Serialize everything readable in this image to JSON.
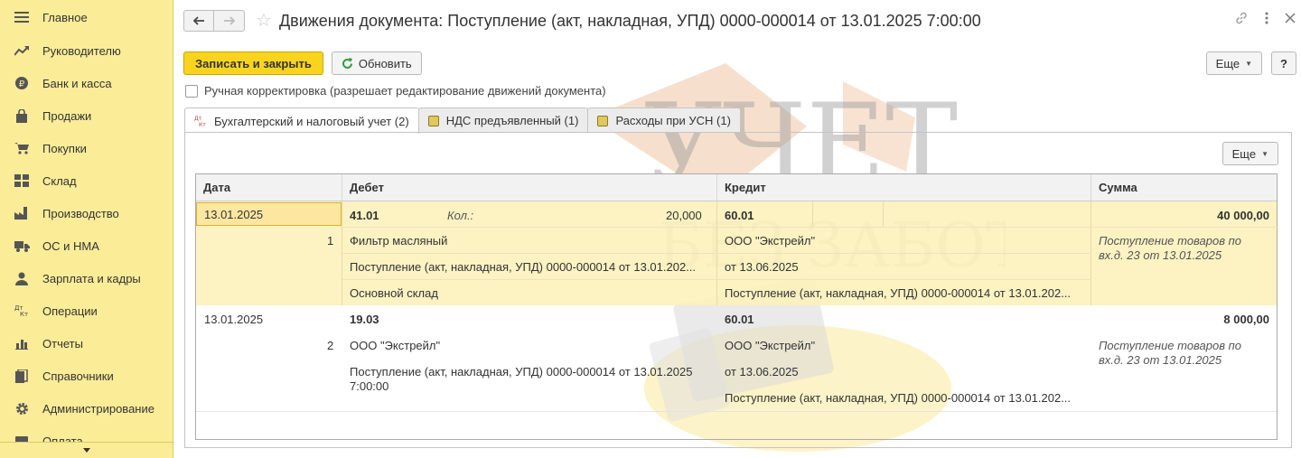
{
  "sidebar": {
    "items": [
      {
        "label": "Главное",
        "icon": "menu-icon"
      },
      {
        "label": "Руководителю",
        "icon": "trend-icon"
      },
      {
        "label": "Банк и касса",
        "icon": "ruble-icon"
      },
      {
        "label": "Продажи",
        "icon": "bag-icon"
      },
      {
        "label": "Покупки",
        "icon": "cart-icon"
      },
      {
        "label": "Склад",
        "icon": "warehouse-icon"
      },
      {
        "label": "Производство",
        "icon": "factory-icon"
      },
      {
        "label": "ОС и НМА",
        "icon": "truck-icon"
      },
      {
        "label": "Зарплата и кадры",
        "icon": "person-icon"
      },
      {
        "label": "Операции",
        "icon": "dt-kt-icon"
      },
      {
        "label": "Отчеты",
        "icon": "bar-chart-icon"
      },
      {
        "label": "Справочники",
        "icon": "books-icon"
      },
      {
        "label": "Администрирование",
        "icon": "gear-icon"
      },
      {
        "label": "Оплата",
        "icon": "payment-icon"
      }
    ]
  },
  "header": {
    "title": "Движения документа: Поступление (акт, накладная, УПД) 0000-000014 от 13.01.2025 7:00:00"
  },
  "toolbar": {
    "save_close": "Записать и закрыть",
    "refresh": "Обновить",
    "more": "Еще",
    "help": "?"
  },
  "manual_edit": {
    "label": "Ручная корректировка (разрешает редактирование движений документа)",
    "checked": false
  },
  "tabs": [
    {
      "label": "Бухгалтерский и налоговый учет (2)",
      "active": true
    },
    {
      "label": "НДС предъявленный (1)",
      "active": false
    },
    {
      "label": "Расходы при УСН (1)",
      "active": false
    }
  ],
  "panel": {
    "more": "Еще"
  },
  "table": {
    "columns": [
      "Дата",
      "Дебет",
      "Кредит",
      "Сумма"
    ],
    "rows": [
      {
        "date": "13.01.2025",
        "num": "1",
        "debit_account": "41.01",
        "qty_label": "Кол.:",
        "qty_value": "20,000",
        "debit_sub1": "Фильтр масляный",
        "debit_sub2": "Поступление (акт, накладная, УПД) 0000-000014 от 13.01.202...",
        "debit_sub3": "Основной склад",
        "credit_account": "60.01",
        "credit_sub1": "ООО \"Экстрейл\"",
        "credit_sub2": "от 13.06.2025",
        "credit_sub3": "Поступление (акт, накладная, УПД) 0000-000014 от 13.01.202...",
        "amount": "40 000,00",
        "content_line1": "Поступление товаров по",
        "content_line2": "вх.д. 23 от 13.01.2025"
      },
      {
        "date": "13.01.2025",
        "num": "2",
        "debit_account": "19.03",
        "debit_sub1": "ООО \"Экстрейл\"",
        "debit_sub2_line1": "Поступление (акт, накладная, УПД) 0000-000014 от 13.01.2025",
        "debit_sub2_line2": "7:00:00",
        "credit_account": "60.01",
        "credit_sub1": "ООО \"Экстрейл\"",
        "credit_sub2": "от 13.06.2025",
        "credit_sub3": "Поступление (акт, накладная, УПД) 0000-000014 от 13.01.202...",
        "amount": "8 000,00",
        "content_line1": "Поступление товаров по",
        "content_line2": "вх.д. 23 от 13.01.2025"
      }
    ]
  },
  "watermark": {
    "line1": "УЧЕТ",
    "line2": "БЕЗ ЗАБОТ"
  }
}
